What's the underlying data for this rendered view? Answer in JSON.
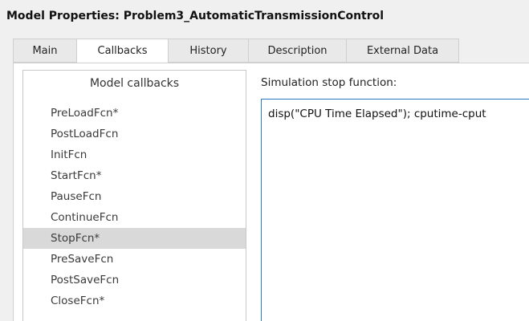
{
  "window": {
    "title": "Model Properties: Problem3_AutomaticTransmissionControl"
  },
  "tabs": [
    {
      "label": "Main",
      "active": false
    },
    {
      "label": "Callbacks",
      "active": true
    },
    {
      "label": "History",
      "active": false
    },
    {
      "label": "Description",
      "active": false
    },
    {
      "label": "External Data",
      "active": false
    }
  ],
  "callbacks": {
    "header": "Model callbacks",
    "items": [
      {
        "label": "PreLoadFcn*"
      },
      {
        "label": "PostLoadFcn"
      },
      {
        "label": "InitFcn"
      },
      {
        "label": "StartFcn*"
      },
      {
        "label": "PauseFcn"
      },
      {
        "label": "ContinueFcn"
      },
      {
        "label": "StopFcn*",
        "selected": true
      },
      {
        "label": "PreSaveFcn"
      },
      {
        "label": "PostSaveFcn"
      },
      {
        "label": "CloseFcn*"
      }
    ]
  },
  "editor": {
    "label": "Simulation stop function:",
    "code": "disp(\"CPU Time Elapsed\"); cputime-cput"
  },
  "colors": {
    "selected_row": "#d9d9d9",
    "editor_border": "#2c7bc4"
  }
}
